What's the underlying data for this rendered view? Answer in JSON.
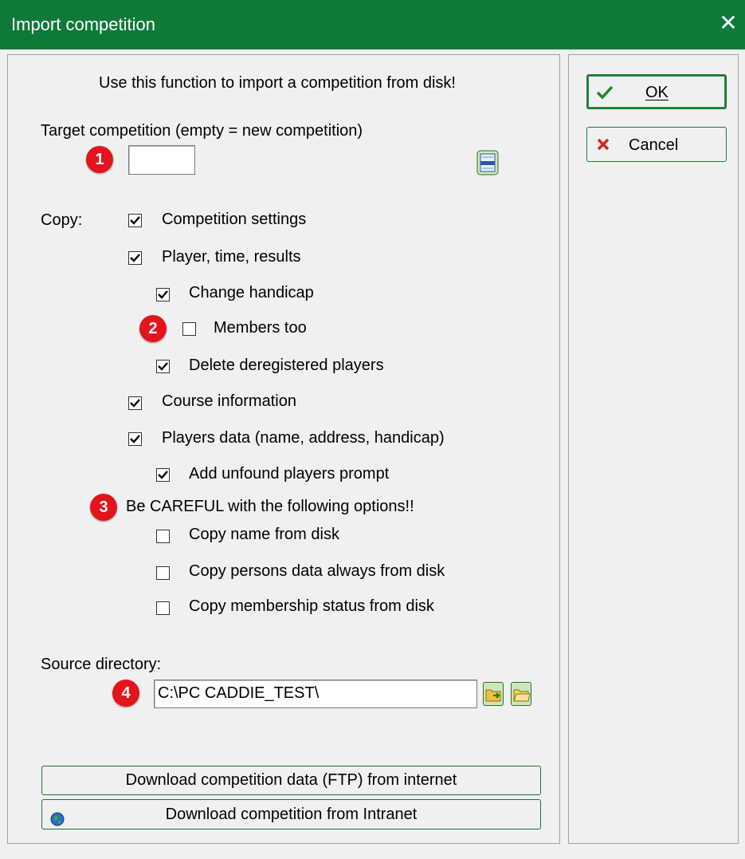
{
  "window": {
    "title": "Import competition",
    "close": "✕"
  },
  "intro": "Use this function to import a competition from disk!",
  "target": {
    "label": "Target competition (empty = new competition)",
    "value": ""
  },
  "copy_label": "Copy:",
  "options": {
    "competition_settings": {
      "label": "Competition settings",
      "checked": true
    },
    "player_time_results": {
      "label": "Player, time, results",
      "checked": true
    },
    "change_handicap": {
      "label": "Change handicap",
      "checked": true
    },
    "members_too": {
      "label": "Members too",
      "checked": false
    },
    "delete_deregistered": {
      "label": "Delete deregistered players",
      "checked": true
    },
    "course_information": {
      "label": "Course information",
      "checked": true
    },
    "players_data": {
      "label": "Players data (name, address, handicap)",
      "checked": true
    },
    "add_unfound": {
      "label": "Add unfound players prompt",
      "checked": true
    },
    "copy_name": {
      "label": "Copy name from disk",
      "checked": false
    },
    "copy_persons": {
      "label": "Copy persons data always from disk",
      "checked": false
    },
    "copy_membership": {
      "label": "Copy membership status from disk",
      "checked": false
    }
  },
  "warning": "Be CAREFUL with the following options!!",
  "source": {
    "label": "Source directory:",
    "value": "C:\\PC CADDIE_TEST\\"
  },
  "badges": [
    "1",
    "2",
    "3",
    "4"
  ],
  "buttons": {
    "ok": "OK",
    "cancel": "Cancel",
    "ftp": "Download competition data (FTP) from internet",
    "intranet": "Download competition from Intranet"
  },
  "colors": {
    "titlebar": "#0e7a3a",
    "badge": "#e3141b"
  }
}
